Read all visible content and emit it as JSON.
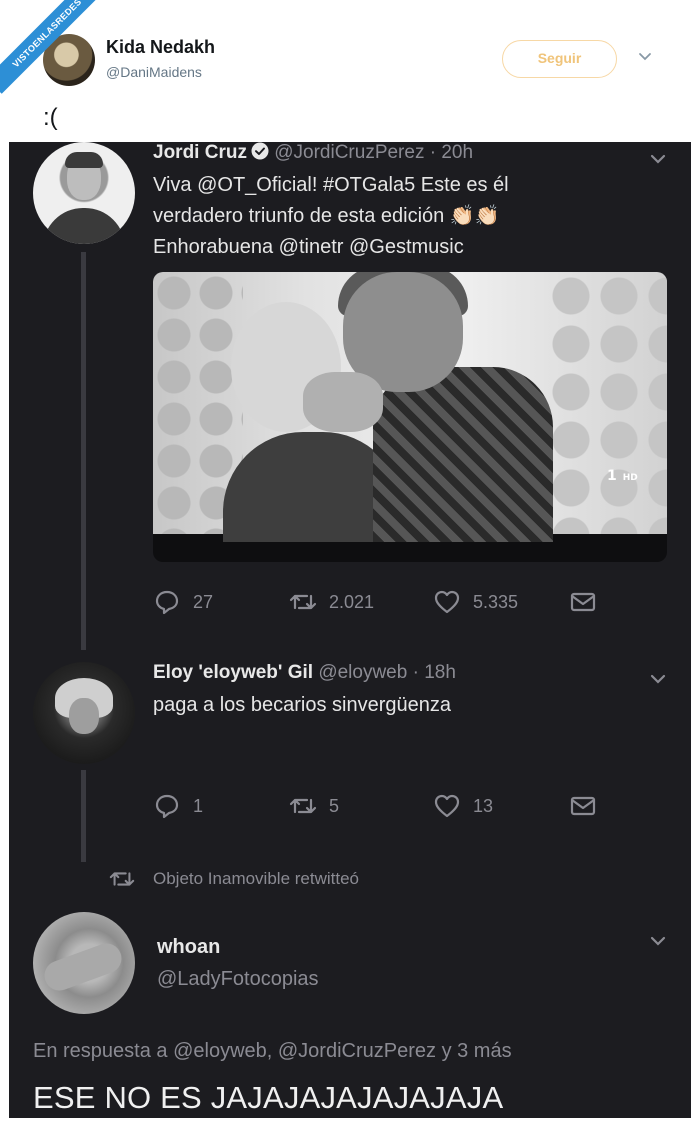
{
  "watermark": "VISTOENLASREDES",
  "outer_tweet": {
    "name": "Kida Nedakh",
    "handle": "@DaniMaidens",
    "follow_label": "Seguir",
    "text": ":("
  },
  "quoted_thread": {
    "tweet1": {
      "name": "Jordi Cruz",
      "handle": "@JordiCruzPerez",
      "time": "20h",
      "line1": "Viva @OT_Oficial! #OTGala5  Este es él",
      "line2": "verdadero triunfo de esta edición 👏🏻👏🏻",
      "line3": "Enhorabuena @tinetr @Gestmusic",
      "media_logo": "1",
      "media_logo_suffix": "HD",
      "replies": "27",
      "retweets": "2.021",
      "likes": "5.335"
    },
    "tweet2": {
      "name": "Eloy 'eloyweb' Gil",
      "handle": "@eloyweb",
      "time": "18h",
      "text": "paga a los becarios sinvergüenza",
      "replies": "1",
      "retweets": "5",
      "likes": "13"
    },
    "retweet_notice": "Objeto Inamovible retwitteó",
    "tweet3": {
      "name": "whoan",
      "handle": "@LadyFotocopias",
      "replying_to": "En respuesta a @eloyweb, @JordiCruzPerez y 3 más",
      "text": "ESE NO ES JAJAJAJAJAJAJAJA"
    }
  },
  "colors": {
    "dark_bg": "#1c1c20",
    "muted_text": "#8b8b93",
    "follow_border": "#f7d8a6",
    "watermark_blue": "#2d8fd6"
  }
}
